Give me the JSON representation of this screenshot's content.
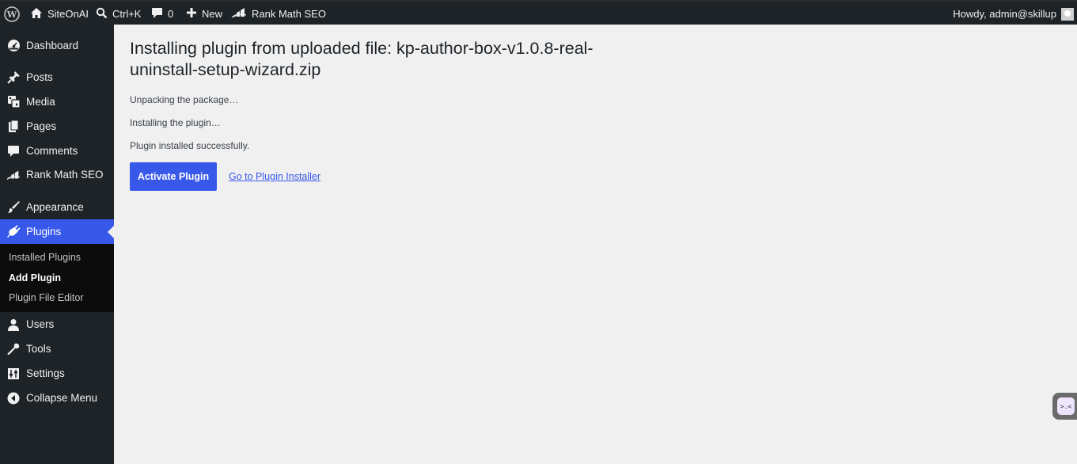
{
  "adminbar": {
    "site_name": "SiteOnAI",
    "search_shortcut": "Ctrl+K",
    "comments_count": "0",
    "new_label": "New",
    "rankmath_label": "Rank Math SEO",
    "howdy": "Howdy, admin@skillup"
  },
  "sidebar": {
    "items": [
      {
        "label": "Dashboard",
        "icon": "dashboard-icon"
      },
      {
        "label": "Posts",
        "icon": "pin-icon"
      },
      {
        "label": "Media",
        "icon": "media-icon"
      },
      {
        "label": "Pages",
        "icon": "pages-icon"
      },
      {
        "label": "Comments",
        "icon": "comment-icon"
      },
      {
        "label": "Rank Math SEO",
        "icon": "rankmath-icon"
      },
      {
        "label": "Appearance",
        "icon": "brush-icon"
      },
      {
        "label": "Plugins",
        "icon": "plugin-icon"
      },
      {
        "label": "Users",
        "icon": "user-icon"
      },
      {
        "label": "Tools",
        "icon": "wrench-icon"
      },
      {
        "label": "Settings",
        "icon": "settings-icon"
      },
      {
        "label": "Collapse Menu",
        "icon": "collapse-icon"
      }
    ],
    "plugins_submenu": [
      "Installed Plugins",
      "Add Plugin",
      "Plugin File Editor"
    ]
  },
  "main": {
    "title": "Installing plugin from uploaded file: kp-author-box-v1.0.8-real-uninstall-setup-wizard.zip",
    "messages": [
      "Unpacking the package…",
      "Installing the plugin…",
      "Plugin installed successfully."
    ],
    "activate_label": "Activate Plugin",
    "installer_link": "Go to Plugin Installer"
  },
  "colors": {
    "accent": "#3858e9",
    "adminbar_bg": "#1d2327",
    "content_bg": "#f0f0f1"
  }
}
